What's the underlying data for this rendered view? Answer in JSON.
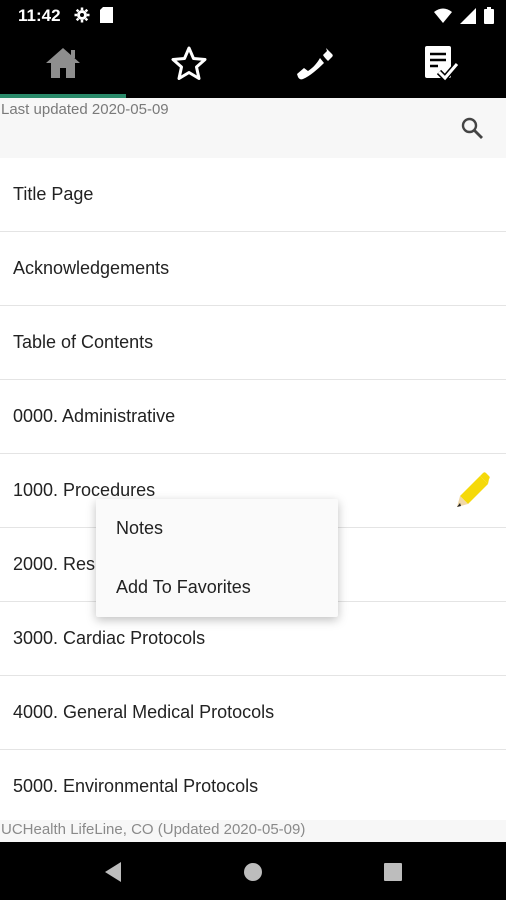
{
  "status": {
    "time": "11:42"
  },
  "tabs": [
    {
      "name": "home"
    },
    {
      "name": "favorites"
    },
    {
      "name": "phone"
    },
    {
      "name": "checklist"
    }
  ],
  "header": {
    "updated": "Last updated 2020-05-09"
  },
  "list": {
    "items": [
      "Title Page",
      "Acknowledgements",
      "Table of Contents",
      "0000. Administrative",
      "1000. Procedures",
      "2000. Res",
      "3000. Cardiac Protocols",
      "4000. General Medical Protocols",
      "5000. Environmental Protocols"
    ]
  },
  "context_menu": {
    "notes": "Notes",
    "add_favorites": "Add To Favorites"
  },
  "footer": {
    "text": "UCHealth LifeLine, CO (Updated 2020-05-09)"
  },
  "colors": {
    "accent": "#2a8a6a",
    "pencil": "#f5d90a"
  }
}
